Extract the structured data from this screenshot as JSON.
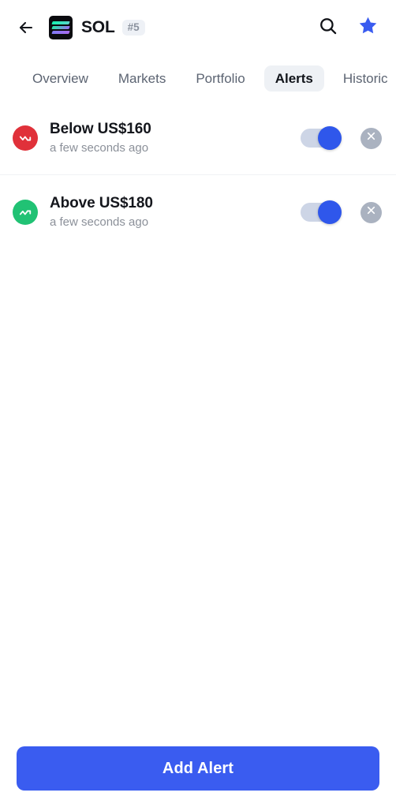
{
  "header": {
    "back_icon": "arrow-left-icon",
    "coin_logo_icon": "solana-logo-icon",
    "coin_symbol": "SOL",
    "rank_badge": "#5",
    "search_icon": "search-icon",
    "favorite_icon": "star-icon"
  },
  "tabs": [
    {
      "label": "Overview",
      "active": false
    },
    {
      "label": "Markets",
      "active": false
    },
    {
      "label": "Portfolio",
      "active": false
    },
    {
      "label": "Alerts",
      "active": true
    },
    {
      "label": "Historic",
      "active": false
    }
  ],
  "alerts": [
    {
      "title": "Below US$160",
      "subtitle": "a few seconds ago",
      "direction_icon": "trend-down-icon",
      "direction_color": "#e0313a",
      "enabled": true,
      "remove_icon": "close-circle-icon"
    },
    {
      "title": "Above US$180",
      "subtitle": "a few seconds ago",
      "direction_icon": "trend-up-icon",
      "direction_color": "#21c274",
      "enabled": true,
      "remove_icon": "close-circle-icon"
    }
  ],
  "footer": {
    "add_alert_label": "Add Alert"
  },
  "colors": {
    "accent_blue": "#3a5cf0",
    "toggle_on_thumb": "#2f57eb",
    "toggle_track": "#cdd5e6",
    "up_green": "#21c274",
    "down_red": "#e0313a",
    "muted_text": "#8b9099",
    "tab_active_bg": "#eef1f5"
  }
}
